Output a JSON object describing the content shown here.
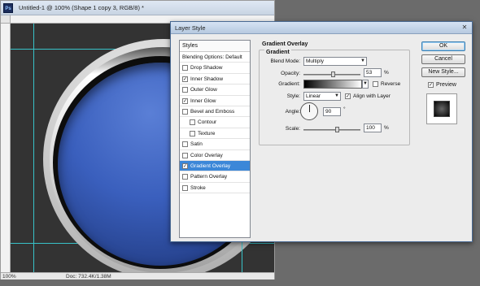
{
  "document": {
    "title": "Untitled-1 @ 100% (Shape 1 copy 3, RGB/8) *",
    "app_icon": "Ps",
    "zoom": "100%",
    "doc_info": "Doc: 732.4K/1.38M"
  },
  "dialog": {
    "title": "Layer Style",
    "close_glyph": "✕",
    "styles_header": "Styles",
    "styles": [
      {
        "label": "Blending Options: Default",
        "checkbox": false
      },
      {
        "label": "Drop Shadow",
        "checkbox": true,
        "checked": false
      },
      {
        "label": "Inner Shadow",
        "checkbox": true,
        "checked": true
      },
      {
        "label": "Outer Glow",
        "checkbox": true,
        "checked": false
      },
      {
        "label": "Inner Glow",
        "checkbox": true,
        "checked": true
      },
      {
        "label": "Bevel and Emboss",
        "checkbox": true,
        "checked": false
      },
      {
        "label": "Contour",
        "checkbox": true,
        "checked": false,
        "indent": true
      },
      {
        "label": "Texture",
        "checkbox": true,
        "checked": false,
        "indent": true
      },
      {
        "label": "Satin",
        "checkbox": true,
        "checked": false
      },
      {
        "label": "Color Overlay",
        "checkbox": true,
        "checked": false
      },
      {
        "label": "Gradient Overlay",
        "checkbox": true,
        "checked": true,
        "selected": true
      },
      {
        "label": "Pattern Overlay",
        "checkbox": true,
        "checked": false
      },
      {
        "label": "Stroke",
        "checkbox": true,
        "checked": false
      }
    ],
    "panel": {
      "section_title": "Gradient Overlay",
      "group_title": "Gradient",
      "blend_mode_label": "Blend Mode:",
      "blend_mode_value": "Multiply",
      "opacity_label": "Opacity:",
      "opacity_value": "53",
      "opacity_fraction": 0.53,
      "percent": "%",
      "gradient_label": "Gradient:",
      "reverse_label": "Reverse",
      "reverse_checked": false,
      "style_label": "Style:",
      "style_value": "Linear",
      "align_label": "Align with Layer",
      "align_checked": true,
      "angle_label": "Angle:",
      "angle_value": "90",
      "degree": "°",
      "scale_label": "Scale:",
      "scale_value": "100",
      "scale_fraction": 0.6
    },
    "buttons": {
      "ok": "OK",
      "cancel": "Cancel",
      "new_style": "New Style...",
      "preview_label": "Preview",
      "preview_checked": true
    }
  }
}
